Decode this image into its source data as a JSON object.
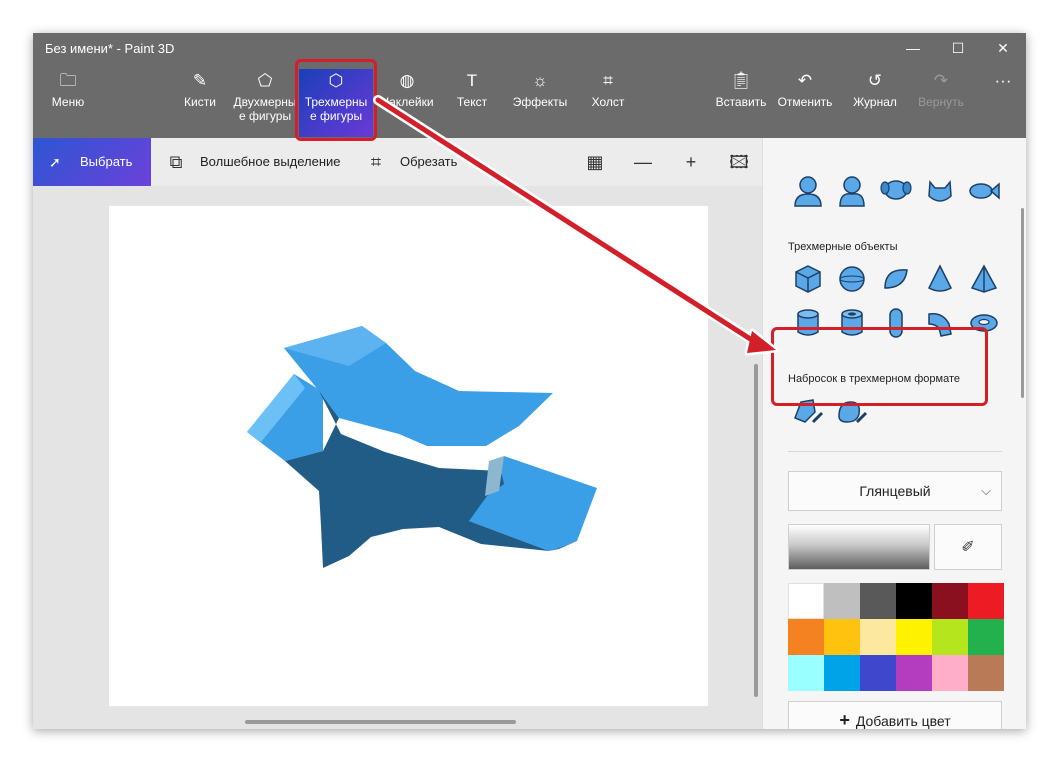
{
  "window": {
    "title": "Без имени* - Paint 3D"
  },
  "window_controls": {
    "minimize": "—",
    "maximize": "☐",
    "close": "✕"
  },
  "ribbon": {
    "menu": "Меню",
    "brushes": "Кисти",
    "shapes2d_line1": "Двухмерны",
    "shapes2d_line2": "е фигуры",
    "shapes3d_line1": "Трехмерны",
    "shapes3d_line2": "е фигуры",
    "stickers": "Наклейки",
    "text": "Текст",
    "effects": "Эффекты",
    "canvas": "Холст",
    "paste": "Вставить",
    "undo": "Отменить",
    "history": "Журнал",
    "redo": "Вернуть",
    "more": "···"
  },
  "toolbar": {
    "select": "Выбрать",
    "magic_select": "Волшебное выделение",
    "crop": "Обрезать"
  },
  "panel": {
    "objects_label": "Трехмерные объекты",
    "doodle_label": "Набросок в трехмерном формате",
    "material": "Глянцевый",
    "add_color": "Добавить цвет"
  },
  "colors": {
    "accent": "#2d56d3",
    "highlight": "#d31f2a",
    "model_light": "#3b9fe8",
    "model_dark": "#215c86",
    "palette": [
      "#ffffff",
      "#bfbfbf",
      "#595959",
      "#000000",
      "#8a0f1f",
      "#ed1c24",
      "#f58220",
      "#ffc20e",
      "#fde8a0",
      "#fff200",
      "#b5e61d",
      "#22b14c",
      "#99ffff",
      "#00a2e8",
      "#3f48cc",
      "#b43dbf",
      "#ffaec9",
      "#b97a57"
    ]
  }
}
